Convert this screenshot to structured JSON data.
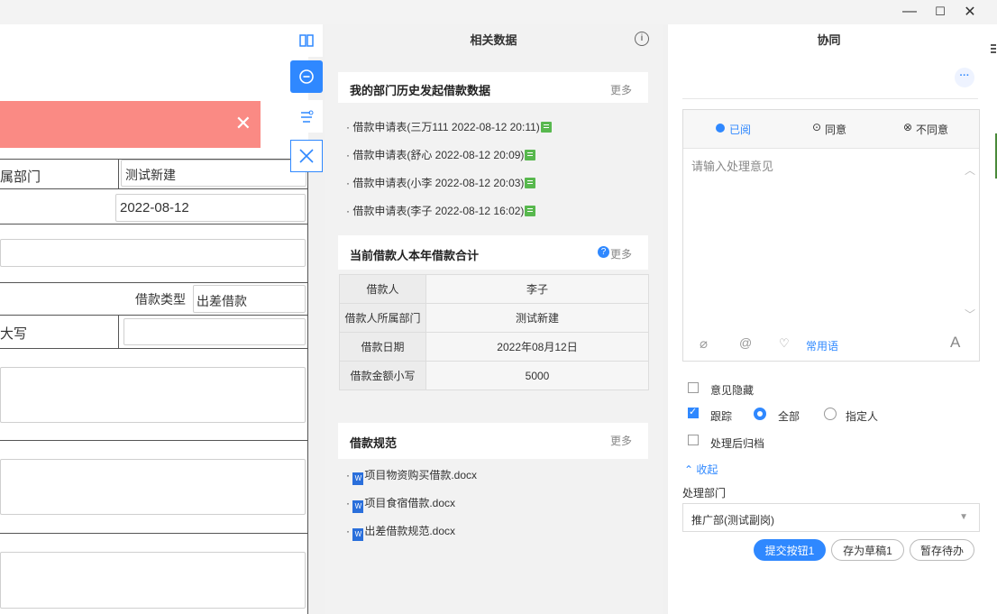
{
  "window": {
    "minimize": "—",
    "maximize": "☐",
    "close": "✕"
  },
  "form": {
    "dept_label": "属部门",
    "dept_value": "测试新建",
    "date_value": "2022-08-12",
    "loan_type_label": "借款类型",
    "loan_type_value": "出差借款",
    "amount_label": "大写"
  },
  "middle": {
    "title": "相关数据",
    "section1": {
      "title": "我的部门历史发起借款数据",
      "more": "更多",
      "items": [
        "借款申请表(三万111 2022-08-12 20:11)",
        "借款申请表(舒心 2022-08-12 20:09)",
        "借款申请表(小李 2022-08-12 20:03)",
        "借款申请表(李子 2022-08-12 16:02)"
      ]
    },
    "section2": {
      "title": "当前借款人本年借款合计",
      "more": "更多",
      "rows": [
        {
          "k": "借款人",
          "v": "李子"
        },
        {
          "k": "借款人所属部门",
          "v": "测试新建"
        },
        {
          "k": "借款日期",
          "v": "2022年08月12日"
        },
        {
          "k": "借款金额小写",
          "v": "5000"
        }
      ]
    },
    "section3": {
      "title": "借款规范",
      "more": "更多",
      "files": [
        "项目物资购买借款.docx",
        "项目食宿借款.docx",
        "出差借款规范.docx"
      ]
    }
  },
  "right": {
    "title": "协同",
    "more_btn": "···",
    "tabs": {
      "read": "已阅",
      "agree": "同意",
      "disagree": "不同意"
    },
    "opinion_placeholder": "请输入处理意见",
    "phrases": "常用语",
    "font_btn": "A",
    "hide_opinion": "意见隐藏",
    "track": "跟踪",
    "track_all": "全部",
    "track_person": "指定人",
    "archive": "处理后归档",
    "collapse": "收起",
    "dept_label": "处理部门",
    "dept_value": "推广部(测试副岗)",
    "submit": "提交按钮1",
    "draft": "存为草稿1",
    "pending": "暂存待办"
  },
  "colors": {
    "accent": "#2f88ff",
    "banner": "#fa8a84",
    "doc_green": "#58b84e"
  }
}
